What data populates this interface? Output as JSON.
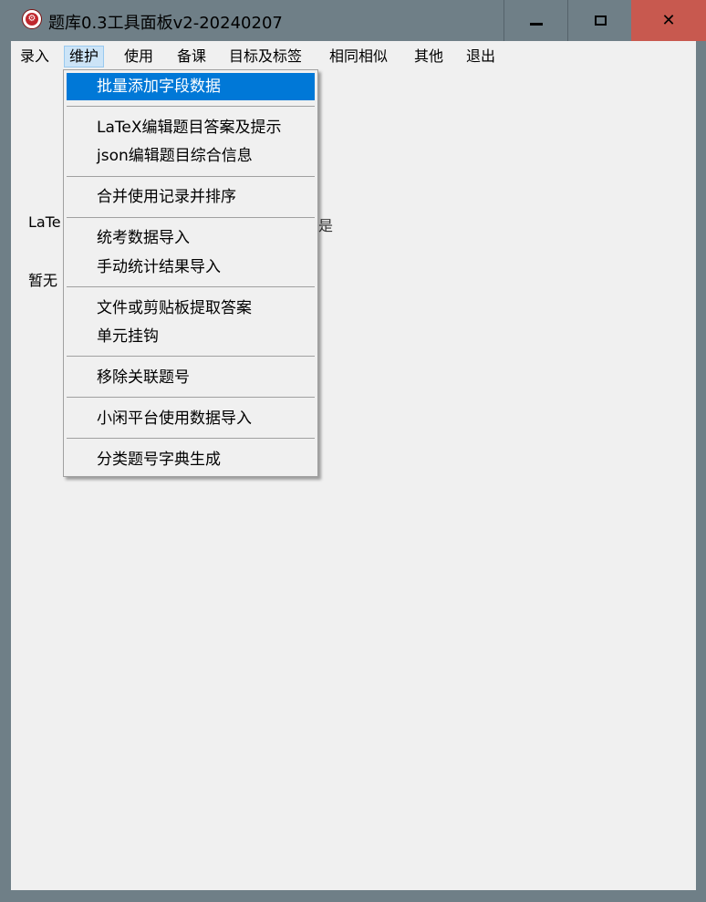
{
  "window": {
    "title": "题库0.3工具面板v2-20240207",
    "icon": "app-logo-icon",
    "controls": {
      "minimize": "minimize-icon",
      "maximize": "maximize-icon",
      "close": "close-icon"
    },
    "close_color": "#c8594f"
  },
  "menubar": {
    "items": [
      "录入",
      "维护",
      "使用",
      "备课",
      "目标及标签",
      "相同相似",
      "其他",
      "退出"
    ],
    "active": "维护"
  },
  "background": {
    "label1": "LaTe",
    "label1_tail": "是",
    "label2": "暂无"
  },
  "dropdown": {
    "highlight_color": "#0078d7",
    "groups": [
      [
        "批量添加字段数据"
      ],
      [
        "LaTeX编辑题目答案及提示",
        "json编辑题目综合信息"
      ],
      [
        "合并使用记录并排序"
      ],
      [
        "统考数据导入",
        "手动统计结果导入"
      ],
      [
        "文件或剪贴板提取答案",
        "单元挂钩"
      ],
      [
        "移除关联题号"
      ],
      [
        "小闲平台使用数据导入"
      ],
      [
        "分类题号字典生成"
      ]
    ],
    "selected": "批量添加字段数据"
  }
}
